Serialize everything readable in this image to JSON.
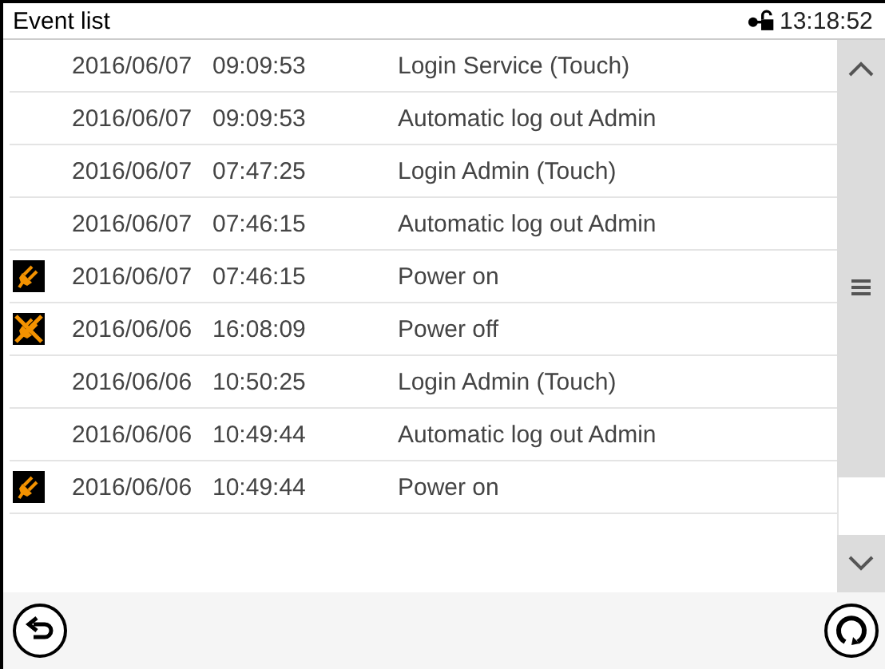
{
  "window": {
    "title": "Event list",
    "time": "13:18:52"
  },
  "events": [
    {
      "kind": "plain",
      "date": "2016/06/07",
      "time": "09:09:53",
      "event": "Login Service (Touch)"
    },
    {
      "kind": "plain",
      "date": "2016/06/07",
      "time": "09:09:53",
      "event": "Automatic log out Admin"
    },
    {
      "kind": "plain",
      "date": "2016/06/07",
      "time": "07:47:25",
      "event": "Login Admin (Touch)"
    },
    {
      "kind": "plain",
      "date": "2016/06/07",
      "time": "07:46:15",
      "event": "Automatic log out Admin"
    },
    {
      "kind": "power_on",
      "date": "2016/06/07",
      "time": "07:46:15",
      "event": "Power on"
    },
    {
      "kind": "power_off",
      "date": "2016/06/06",
      "time": "16:08:09",
      "event": "Power off"
    },
    {
      "kind": "plain",
      "date": "2016/06/06",
      "time": "10:50:25",
      "event": "Login Admin (Touch)"
    },
    {
      "kind": "plain",
      "date": "2016/06/06",
      "time": "10:49:44",
      "event": "Automatic log out Admin"
    },
    {
      "kind": "power_on",
      "date": "2016/06/06",
      "time": "10:49:44",
      "event": "Power on"
    }
  ]
}
